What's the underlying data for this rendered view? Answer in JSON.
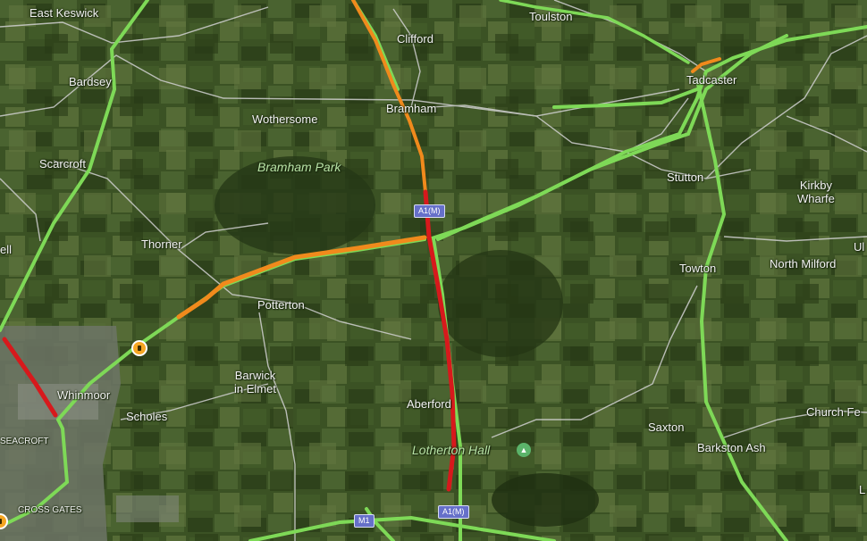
{
  "map": {
    "place_labels": [
      {
        "id": "east-keswick",
        "text": "East Keswick"
      },
      {
        "id": "bardsey",
        "text": "Bardsey"
      },
      {
        "id": "scarcroft",
        "text": "Scarcroft"
      },
      {
        "id": "clifford",
        "text": "Clifford"
      },
      {
        "id": "toulston",
        "text": "Toulston"
      },
      {
        "id": "bramham",
        "text": "Bramham"
      },
      {
        "id": "wothersome",
        "text": "Wothersome"
      },
      {
        "id": "tadcaster",
        "text": "Tadcaster"
      },
      {
        "id": "stutton",
        "text": "Stutton"
      },
      {
        "id": "kirkby-wharfe",
        "text": "Kirkby\nWharfe"
      },
      {
        "id": "thorner",
        "text": "Thorner"
      },
      {
        "id": "ell",
        "text": "ell"
      },
      {
        "id": "towton",
        "text": "Towton"
      },
      {
        "id": "north-milford",
        "text": "North Milford"
      },
      {
        "id": "ul",
        "text": "Ul"
      },
      {
        "id": "potterton",
        "text": "Potterton"
      },
      {
        "id": "barwick-in-elmet",
        "text": "Barwick\nin Elmet"
      },
      {
        "id": "whinmoor",
        "text": "Whinmoor"
      },
      {
        "id": "aberford",
        "text": "Aberford"
      },
      {
        "id": "scholes",
        "text": "Scholes"
      },
      {
        "id": "saxton",
        "text": "Saxton"
      },
      {
        "id": "church-fe",
        "text": "Church Fe"
      },
      {
        "id": "barkston-ash",
        "text": "Barkston Ash"
      },
      {
        "id": "seacroft",
        "text": "SEACROFT"
      },
      {
        "id": "cross-gates",
        "text": "CROSS GATES"
      },
      {
        "id": "l",
        "text": "L"
      }
    ],
    "park_labels": [
      {
        "id": "bramham-park",
        "text": "Bramham Park"
      },
      {
        "id": "lotherton-hall",
        "text": "Lotherton Hall"
      }
    ],
    "road_shields": [
      {
        "id": "a1m-north",
        "text": "A1(M)"
      },
      {
        "id": "a1m-south",
        "text": "A1(M)"
      },
      {
        "id": "m1",
        "text": "M1"
      }
    ],
    "traffic_colors": {
      "free_flow": "#7ed957",
      "slow": "#f08a1c",
      "heavy": "#d7191c",
      "minor_road": "#d9d9d9"
    }
  }
}
